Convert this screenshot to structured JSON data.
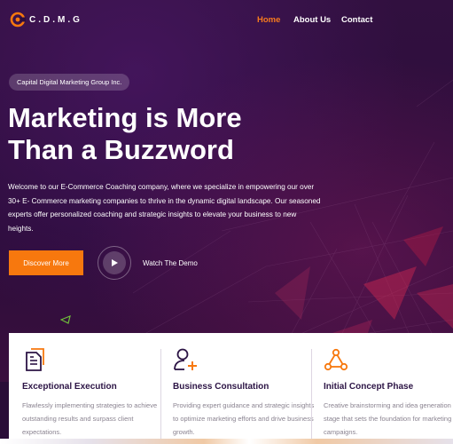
{
  "brand": {
    "name": "C.D.M.G",
    "accent": "#f7780e"
  },
  "nav": {
    "items": [
      {
        "label": "Home",
        "active": true
      },
      {
        "label": "About Us",
        "active": false
      },
      {
        "label": "Contact",
        "active": false
      }
    ]
  },
  "hero": {
    "badge": "Capital Digital Marketing Group Inc.",
    "headline_line1": "Marketing is More",
    "headline_line2": "Than a Buzzword",
    "intro": "Welcome to our E-Commerce Coaching company, where we specialize in empowering our over 30+ E- Commerce marketing companies to thrive in the dynamic digital landscape. Our seasoned experts offer personalized coaching and strategic insights to elevate your business to new heights.",
    "cta_label": "Discover More",
    "video_label": "Watch The Demo"
  },
  "features": [
    {
      "icon": "document-icon",
      "title": "Exceptional Execution",
      "text": "Flawlessly implementing strategies to achieve outstanding results and surpass client expectations."
    },
    {
      "icon": "add-user-icon",
      "title": "Business Consultation",
      "text": "Providing expert guidance and strategic insights to optimize marketing efforts and drive business growth."
    },
    {
      "icon": "network-icon",
      "title": "Initial Concept Phase",
      "text": "Creative brainstorming and idea generation stage that sets the foundation for marketing campaigns."
    }
  ]
}
